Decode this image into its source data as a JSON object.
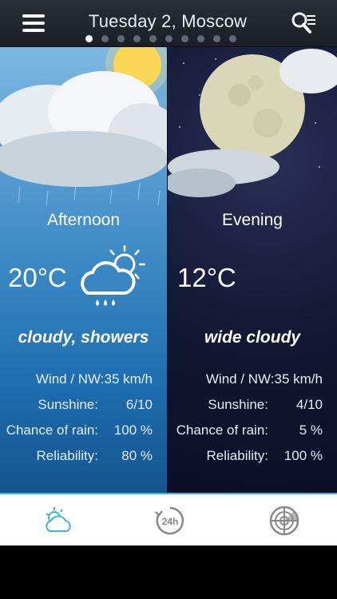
{
  "header": {
    "title": "Tuesday 2, Moscow",
    "page_dots": 10,
    "active_dot": 0
  },
  "panels": [
    {
      "period": "Afternoon",
      "temperature": "20°C",
      "condition": "cloudy, showers",
      "icon": "cloud-sun-rain-icon",
      "stats": [
        {
          "label": "Wind / NW:35 km/h",
          "value": ""
        },
        {
          "label": "Sunshine:",
          "value": "6/10"
        },
        {
          "label": "Chance of rain:",
          "value": "100 %"
        },
        {
          "label": "Reliability:",
          "value": "80 %"
        }
      ]
    },
    {
      "period": "Evening",
      "temperature": "12°C",
      "condition": "wide cloudy",
      "icon": "moon-cloud-icon",
      "stats": [
        {
          "label": "Wind / NW:35 km/h",
          "value": ""
        },
        {
          "label": "Sunshine:",
          "value": "4/10"
        },
        {
          "label": "Chance of rain:",
          "value": "5 %"
        },
        {
          "label": "Reliability:",
          "value": "100 %"
        }
      ]
    }
  ],
  "tabbar": {
    "tabs": [
      {
        "icon": "weather-forecast-icon",
        "active": true
      },
      {
        "icon": "24h-icon",
        "label": "24h",
        "active": false
      },
      {
        "icon": "radar-icon",
        "active": false
      }
    ]
  },
  "colors": {
    "accent": "#3fb3e0",
    "left_panel": "#1e6eb0",
    "right_panel": "#0b0e26"
  }
}
